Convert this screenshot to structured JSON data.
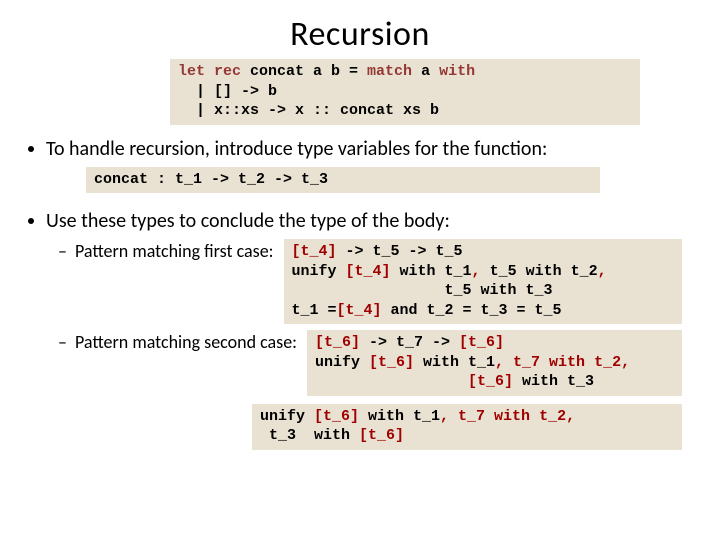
{
  "title": "Recursion",
  "code1": {
    "l1a": "let rec ",
    "l1b": "concat a b = ",
    "l1c": "match ",
    "l1d": "a ",
    "l1e": "with",
    "l2a": "  | [] -> b",
    "l3a": "  | x::xs -> x :: concat xs b"
  },
  "bullet1": "To handle recursion, introduce type variables for the function:",
  "code2": "concat : t_1 -> t_2 -> t_3",
  "bullet2": "Use these types to conclude the type of the body:",
  "sub1": {
    "label": "Pattern matching first case:",
    "l1a": "[t_4]",
    "l1b": " -> t_5 -> t_5",
    "l2a": "unify ",
    "l2b": "[t_4]",
    "l2c": " with t_1",
    "l2d": ",",
    "l2e": " t_5 with t_2",
    "l2f": ",",
    "l3a": "                 t_5 with t_3",
    "l4a": "t_1 =",
    "l4b": "[t_4]",
    "l4c": " and t_2 = t_3 = t_5"
  },
  "sub2": {
    "label": "Pattern matching second case:",
    "l1a": "[t_6]",
    "l1b": " -> t_7 -> ",
    "l1c": "[t_6]",
    "l2a": "unify ",
    "l2b": "[t_6]",
    "l2c": " with t_1",
    "l2d": ", t_7 with t_2",
    "l2e": ",",
    "l3a": "                 ",
    "l3b": "[t_6]",
    "l3c": " with t_3"
  },
  "code_last": {
    "l1a": "unify ",
    "l1b": "[t_6]",
    "l1c": " with t_1",
    "l1d": ", t_7 with t_2",
    "l1e": ",",
    "l2a": " t_3  with ",
    "l2b": "[t_6]"
  }
}
